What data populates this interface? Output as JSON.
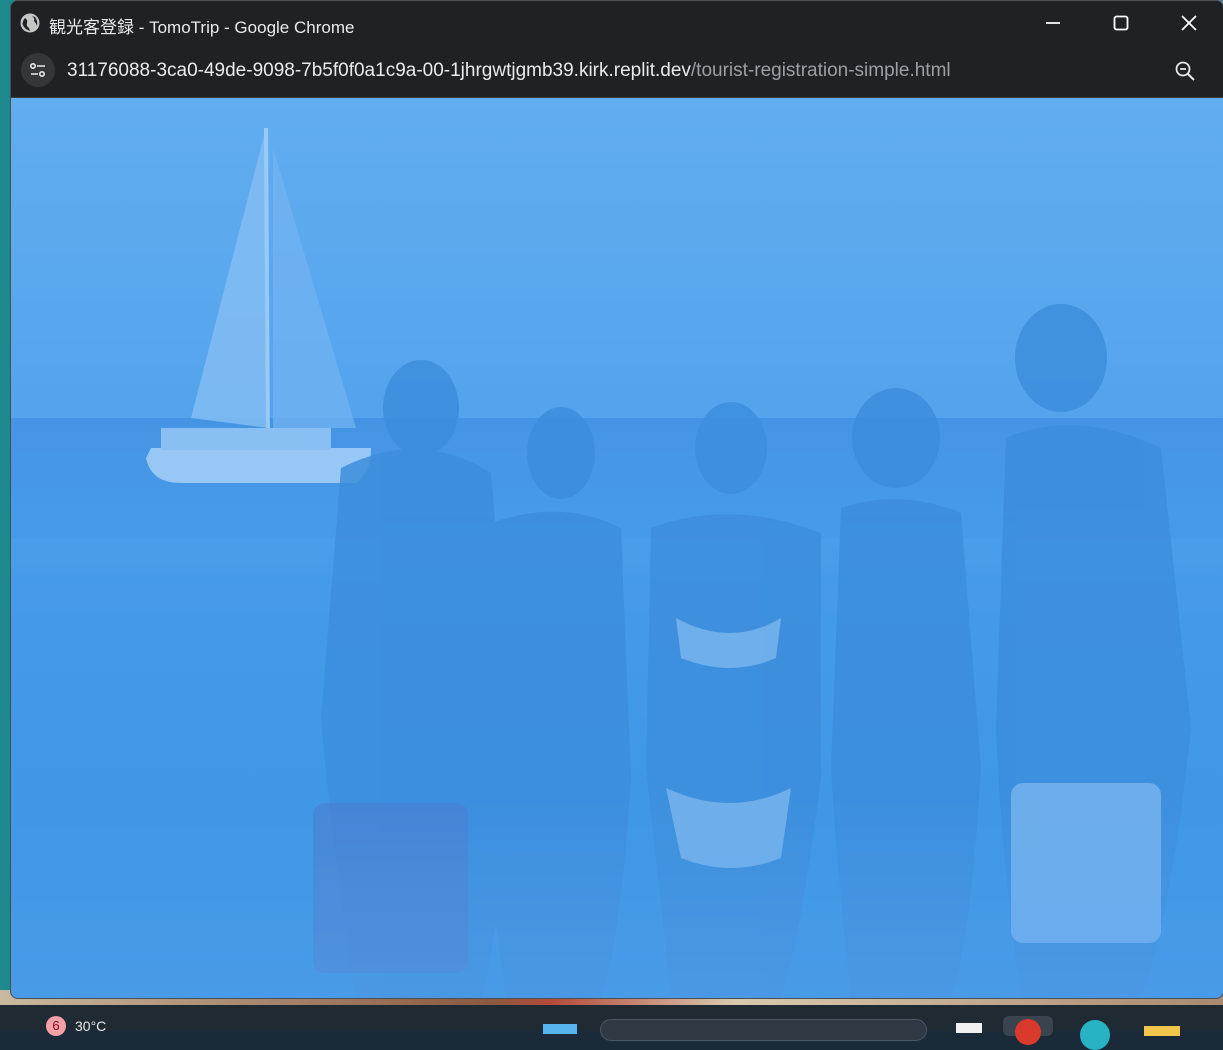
{
  "window": {
    "title": "観光客登録 - TomoTrip - Google Chrome",
    "minimize_icon": "minimize-icon",
    "maximize_icon": "maximize-icon",
    "close_icon": "close-icon"
  },
  "addressbar": {
    "host": "31176088-3ca0-49de-9098-7b5f0f0a1c9a-00-1jhrgwtjgmb39.kirk.replit.dev",
    "path": "/tourist-registration-simple.html",
    "site_info_icon": "tune-icon",
    "zoom_icon": "zoom-out-icon"
  },
  "page": {
    "background": "beach-photo-blue-overlay",
    "overlay_color": "#4a9de8"
  },
  "taskbar": {
    "weather_badge": "6",
    "weather_temp": "30°C"
  }
}
